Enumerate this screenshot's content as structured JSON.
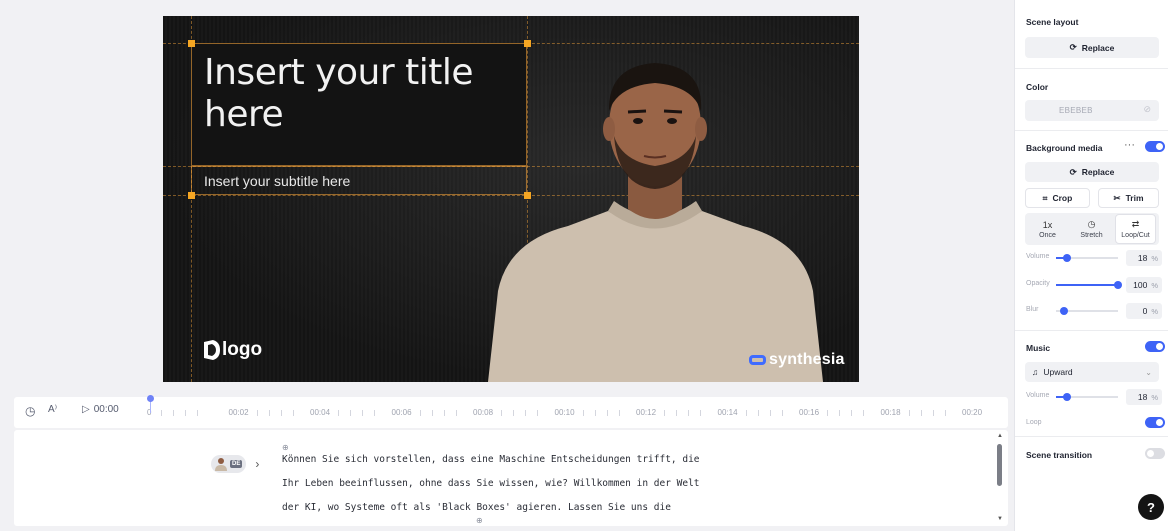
{
  "scene": {
    "title": "Insert your title here",
    "subtitle": "Insert your subtitle here",
    "logo_text": "logo",
    "brand_text": "synthesia"
  },
  "timeline": {
    "current_time": "00:00",
    "labels": [
      "0",
      "00:02",
      "00:04",
      "00:06",
      "00:08",
      "00:10",
      "00:12",
      "00:14",
      "00:16",
      "00:18",
      "00:20"
    ]
  },
  "script": {
    "lang_badge": "DE",
    "lines": [
      "Können Sie sich vorstellen, dass eine Maschine Entscheidungen trifft, die",
      "Ihr Leben beeinflussen, ohne dass Sie wissen, wie? Willkommen in der Welt",
      "der KI, wo Systeme oft als 'Black Boxes' agieren. Lassen Sie uns die"
    ]
  },
  "panel": {
    "scene_layout": {
      "title": "Scene layout",
      "replace_label": "Replace"
    },
    "color": {
      "title": "Color",
      "value": "EBEBEB"
    },
    "background_media": {
      "title": "Background media",
      "enabled": true,
      "replace_label": "Replace",
      "crop_label": "Crop",
      "trim_label": "Trim",
      "modes": [
        {
          "top": "1x",
          "label": "Once"
        },
        {
          "top": "",
          "label": "Stretch"
        },
        {
          "top": "",
          "label": "Loop/Cut"
        }
      ],
      "active_mode": "Loop/Cut",
      "volume": {
        "label": "Volume",
        "value": "18",
        "unit": "%",
        "fraction": 0.18
      },
      "opacity": {
        "label": "Opacity",
        "value": "100",
        "unit": "%",
        "fraction": 1.0
      },
      "blur": {
        "label": "Blur",
        "value": "0",
        "unit": "%",
        "fraction": 0.0
      }
    },
    "music": {
      "title": "Music",
      "enabled": true,
      "track": "Upward",
      "volume": {
        "label": "Volume",
        "value": "18",
        "unit": "%",
        "fraction": 0.18
      },
      "loop_label": "Loop",
      "loop_enabled": true
    },
    "scene_transition": {
      "title": "Scene transition",
      "enabled": false
    }
  },
  "help_label": "?",
  "colors": {
    "accent": "#3e63f6",
    "selection": "#f5a623",
    "scene_bg": "#1f1f1f"
  }
}
